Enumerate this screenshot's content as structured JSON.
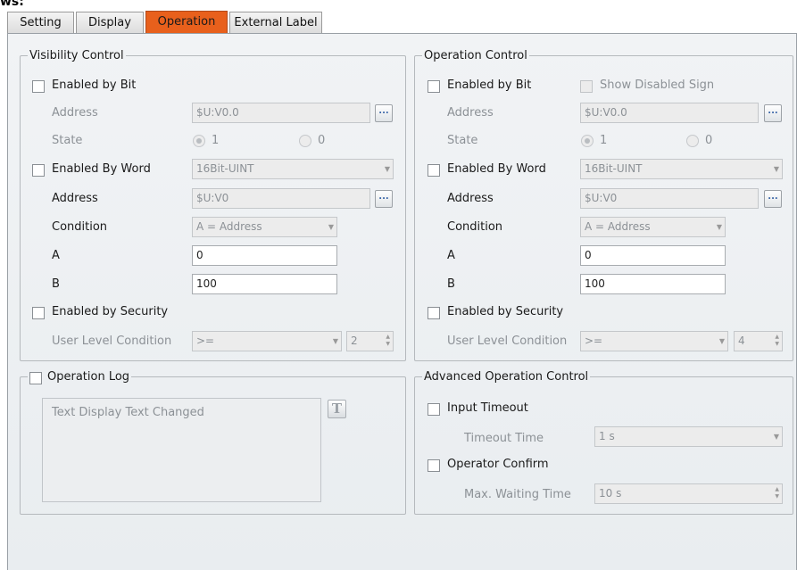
{
  "tabs": [
    "Setting",
    "Display",
    "Operation",
    "External Label"
  ],
  "active_tab": "Operation",
  "visibility": {
    "title": "Visibility Control",
    "enabled_by_bit": "Enabled by Bit",
    "address_label": "Address",
    "address_value": "$U:V0.0",
    "browse": "...",
    "state_label": "State",
    "state_1": "1",
    "state_0": "0",
    "enabled_by_word": "Enabled By Word",
    "word_type": "16Bit-UINT",
    "word_address_label": "Address",
    "word_address_value": "$U:V0",
    "condition_label": "Condition",
    "condition_value": "A = Address",
    "a_label": "A",
    "a_value": "0",
    "b_label": "B",
    "b_value": "100",
    "enabled_by_security": "Enabled by Security",
    "user_level_label": "User Level Condition",
    "user_level_op": ">=",
    "user_level_value": "2"
  },
  "operation": {
    "title": "Operation Control",
    "enabled_by_bit": "Enabled by Bit",
    "show_disabled_sign": "Show Disabled Sign",
    "address_label": "Address",
    "address_value": "$U:V0.0",
    "browse": "...",
    "state_label": "State",
    "state_1": "1",
    "state_0": "0",
    "enabled_by_word": "Enabled By Word",
    "word_type": "16Bit-UINT",
    "word_address_label": "Address",
    "word_address_value": "$U:V0",
    "condition_label": "Condition",
    "condition_value": "A = Address",
    "a_label": "A",
    "a_value": "0",
    "b_label": "B",
    "b_value": "100",
    "enabled_by_security": "Enabled by Security",
    "user_level_label": "User Level Condition",
    "user_level_op": ">=",
    "user_level_value": "4"
  },
  "operation_log": {
    "title": "Operation Log",
    "text": "Text Display Text Changed",
    "text_button": "T"
  },
  "advanced": {
    "title": "Advanced Operation Control",
    "input_timeout": "Input Timeout",
    "timeout_time_label": "Timeout Time",
    "timeout_time_value": "1 s",
    "operator_confirm": "Operator Confirm",
    "max_wait_label": "Max. Waiting Time",
    "max_wait_value": "10 s"
  },
  "colors": {
    "active_tab": "#e8601c",
    "panel_bg": "#eef1f3"
  }
}
